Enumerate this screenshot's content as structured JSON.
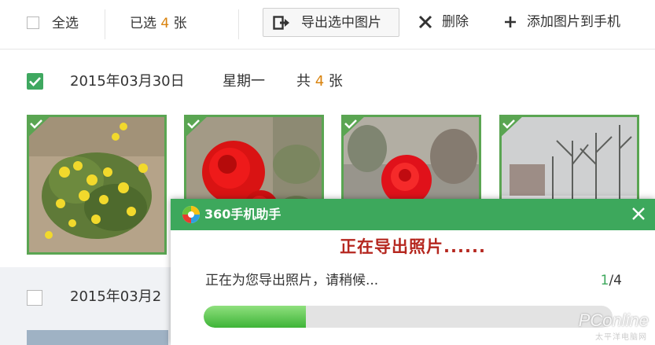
{
  "toolbar": {
    "select_all": "全选",
    "selected_prefix": "已选",
    "selected_count": "4",
    "selected_suffix": "张",
    "export_label": "导出选中图片",
    "delete_label": "删除",
    "add_label": "添加图片到手机"
  },
  "group1": {
    "date": "2015年03月30日",
    "weekday": "星期一",
    "total_prefix": "共",
    "total_count": "4",
    "total_suffix": "张",
    "checked": true,
    "photos": [
      {
        "subject": "yellow-flowers"
      },
      {
        "subject": "red-rose"
      },
      {
        "subject": "red-rose-bush"
      },
      {
        "subject": "snowy-trees"
      }
    ]
  },
  "group2": {
    "date_partial": "2015年03月2",
    "checked": false
  },
  "dialog": {
    "app_name": "360手机助手",
    "main_status": "正在导出照片......",
    "message": "正在为您导出照片，请稍候...",
    "current": "1",
    "total": "/4",
    "progress": 0.25,
    "accent": "#3da85c",
    "status_color": "#b5271f"
  },
  "watermark": {
    "brand": "PConline",
    "sub": "太平洋电脑网"
  }
}
